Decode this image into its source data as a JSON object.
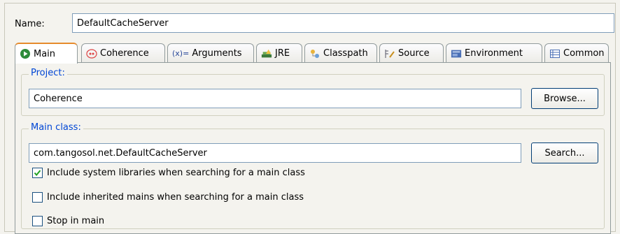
{
  "name": {
    "label": "Name:",
    "value": "DefaultCacheServer"
  },
  "tabs": [
    {
      "label": "Main",
      "icon": "main-icon",
      "active": true
    },
    {
      "label": "Coherence",
      "icon": "coherence-icon"
    },
    {
      "label": "Arguments",
      "icon": "arguments-icon",
      "prefix": "(x)="
    },
    {
      "label": "JRE",
      "icon": "jre-icon"
    },
    {
      "label": "Classpath",
      "icon": "classpath-icon"
    },
    {
      "label": "Source",
      "icon": "source-icon"
    },
    {
      "label": "Environment",
      "icon": "environment-icon"
    },
    {
      "label": "Common",
      "icon": "common-icon"
    }
  ],
  "project": {
    "legend": "Project:",
    "value": "Coherence",
    "browse_label": "Browse..."
  },
  "main_class": {
    "legend": "Main class:",
    "value": "com.tangosol.net.DefaultCacheServer",
    "search_label": "Search..."
  },
  "options": [
    {
      "label": "Include system libraries when searching for a main class",
      "checked": true
    },
    {
      "label": "Include inherited mains when searching for a main class",
      "checked": false
    },
    {
      "label": "Stop in main",
      "checked": false
    }
  ],
  "colors": {
    "accent": "#e68b2c",
    "legend": "#0046d5",
    "input_border": "#7f9db9"
  }
}
